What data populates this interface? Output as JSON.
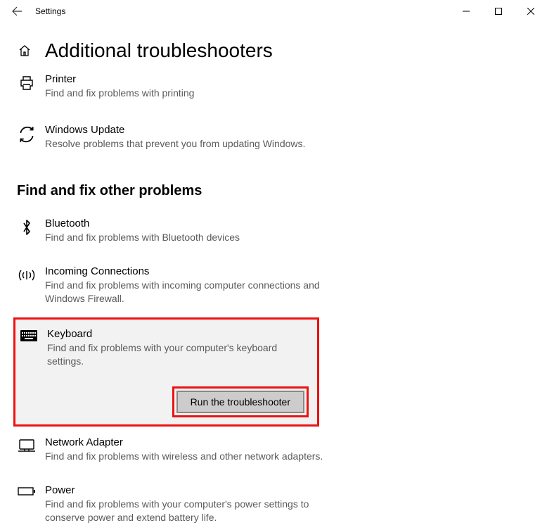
{
  "window": {
    "title": "Settings"
  },
  "page": {
    "heading": "Additional troubleshooters",
    "section2": "Find and fix other problems"
  },
  "top_items": [
    {
      "title": "Printer",
      "desc": "Find and fix problems with printing"
    },
    {
      "title": "Windows Update",
      "desc": "Resolve problems that prevent you from updating Windows."
    }
  ],
  "other_items": [
    {
      "title": "Bluetooth",
      "desc": "Find and fix problems with Bluetooth devices"
    },
    {
      "title": "Incoming Connections",
      "desc": "Find and fix problems with incoming computer connections and Windows Firewall."
    },
    {
      "title": "Keyboard",
      "desc": "Find and fix problems with your computer's keyboard settings."
    },
    {
      "title": "Network Adapter",
      "desc": "Find and fix problems with wireless and other network adapters."
    },
    {
      "title": "Power",
      "desc": "Find and fix problems with your computer's power settings to conserve power and extend battery life."
    }
  ],
  "run_button": "Run the troubleshooter"
}
